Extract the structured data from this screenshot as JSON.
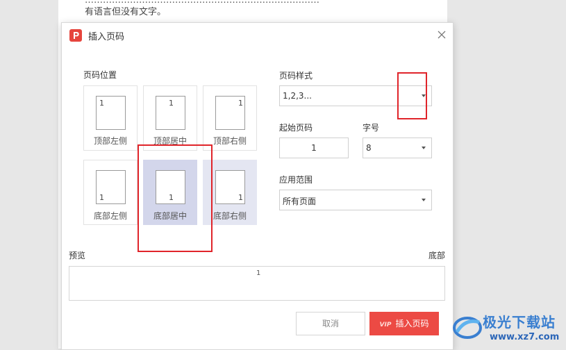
{
  "background_doc": {
    "line1": "……………………………………………………………………",
    "line2": "有语言但没有文字。"
  },
  "dialog": {
    "title": "插入页码",
    "position_label": "页码位置",
    "positions": [
      {
        "label": "顶部左侧",
        "num": "1"
      },
      {
        "label": "顶部居中",
        "num": "1"
      },
      {
        "label": "顶部右侧",
        "num": "1"
      },
      {
        "label": "底部左侧",
        "num": "1"
      },
      {
        "label": "底部居中",
        "num": "1"
      },
      {
        "label": "底部右侧",
        "num": "1"
      }
    ],
    "style_label": "页码样式",
    "style_value": "1,2,3...",
    "start_label": "起始页码",
    "start_value": "1",
    "font_size_label": "字号",
    "font_size_value": "8",
    "scope_label": "应用范围",
    "scope_value": "所有页面",
    "preview_label": "预览",
    "preview_position": "底部",
    "preview_number": "1",
    "cancel_label": "取消",
    "insert_label": "插入页码",
    "vip_badge": "VIP"
  },
  "watermark": {
    "brand": "极光下载站",
    "url": "www.xz7.com"
  },
  "colors": {
    "accent": "#ec4a44",
    "selected_tile": "#d3d6eb",
    "annotation": "#e0242a"
  }
}
